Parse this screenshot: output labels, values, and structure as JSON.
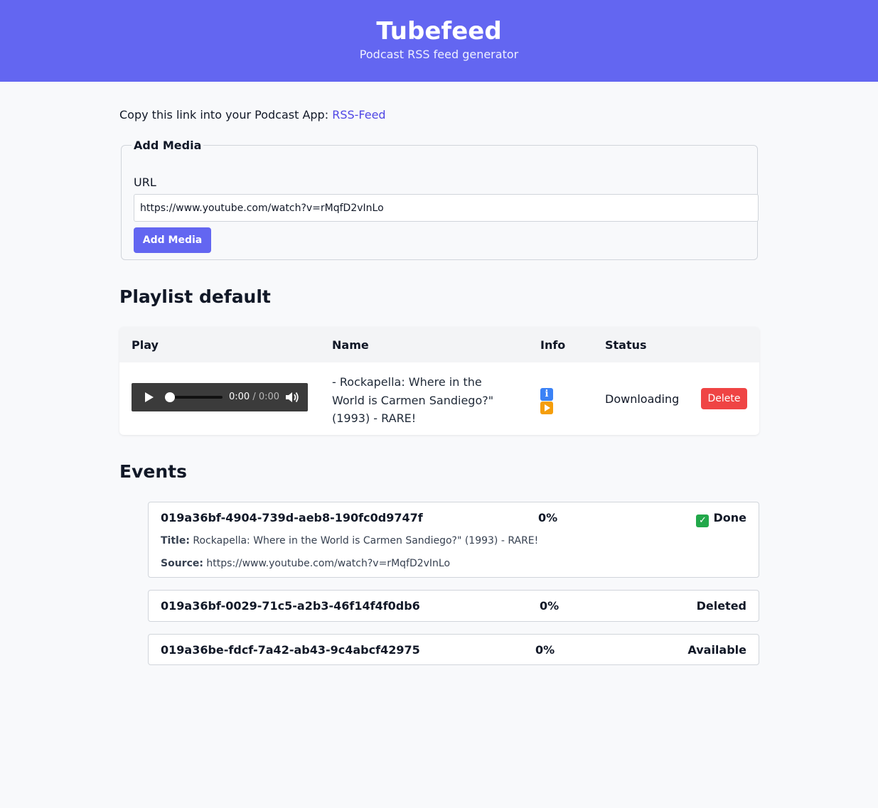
{
  "header": {
    "title": "Tubefeed",
    "subtitle": "Podcast RSS feed generator"
  },
  "feed": {
    "prefix": "Copy this link into your Podcast App:",
    "link_label": "RSS-Feed"
  },
  "add_media": {
    "legend": "Add Media",
    "url_label": "URL",
    "url_value": "https://www.youtube.com/watch?v=rMqfD2vInLo",
    "button_label": "Add Media"
  },
  "playlist": {
    "title": "Playlist default",
    "columns": [
      "Play",
      "Name",
      "Info",
      "Status"
    ],
    "rows": [
      {
        "player_time": "0:00",
        "player_duration": "/ 0:00",
        "name": "- Rockapella: Where in the World is Carmen Sandiego?\" (1993) - RARE!",
        "info_icons": [
          "info-icon",
          "play-icon"
        ],
        "status": "Downloading",
        "delete_label": "Delete"
      }
    ]
  },
  "events": {
    "title": "Events",
    "items": [
      {
        "id": "019a36bf-4904-739d-aeb8-190fc0d9747f",
        "percent": "0%",
        "status": "Done",
        "status_icon": "check-icon",
        "title_label": "Title:",
        "title_value": "Rockapella: Where in the World is Carmen Sandiego?\" (1993) - RARE!",
        "source_label": "Source:",
        "source_value": "https://www.youtube.com/watch?v=rMqfD2vInLo"
      },
      {
        "id": "019a36bf-0029-71c5-a2b3-46f14f4f0db6",
        "percent": "0%",
        "status": "Deleted"
      },
      {
        "id": "019a36be-fdcf-7a42-ab43-9c4abcf42975",
        "percent": "0%",
        "status": "Available"
      }
    ]
  },
  "colors": {
    "accent": "#6366f1",
    "link": "#4f46e5",
    "danger": "#ef4444",
    "background": "#f8f9fb"
  }
}
